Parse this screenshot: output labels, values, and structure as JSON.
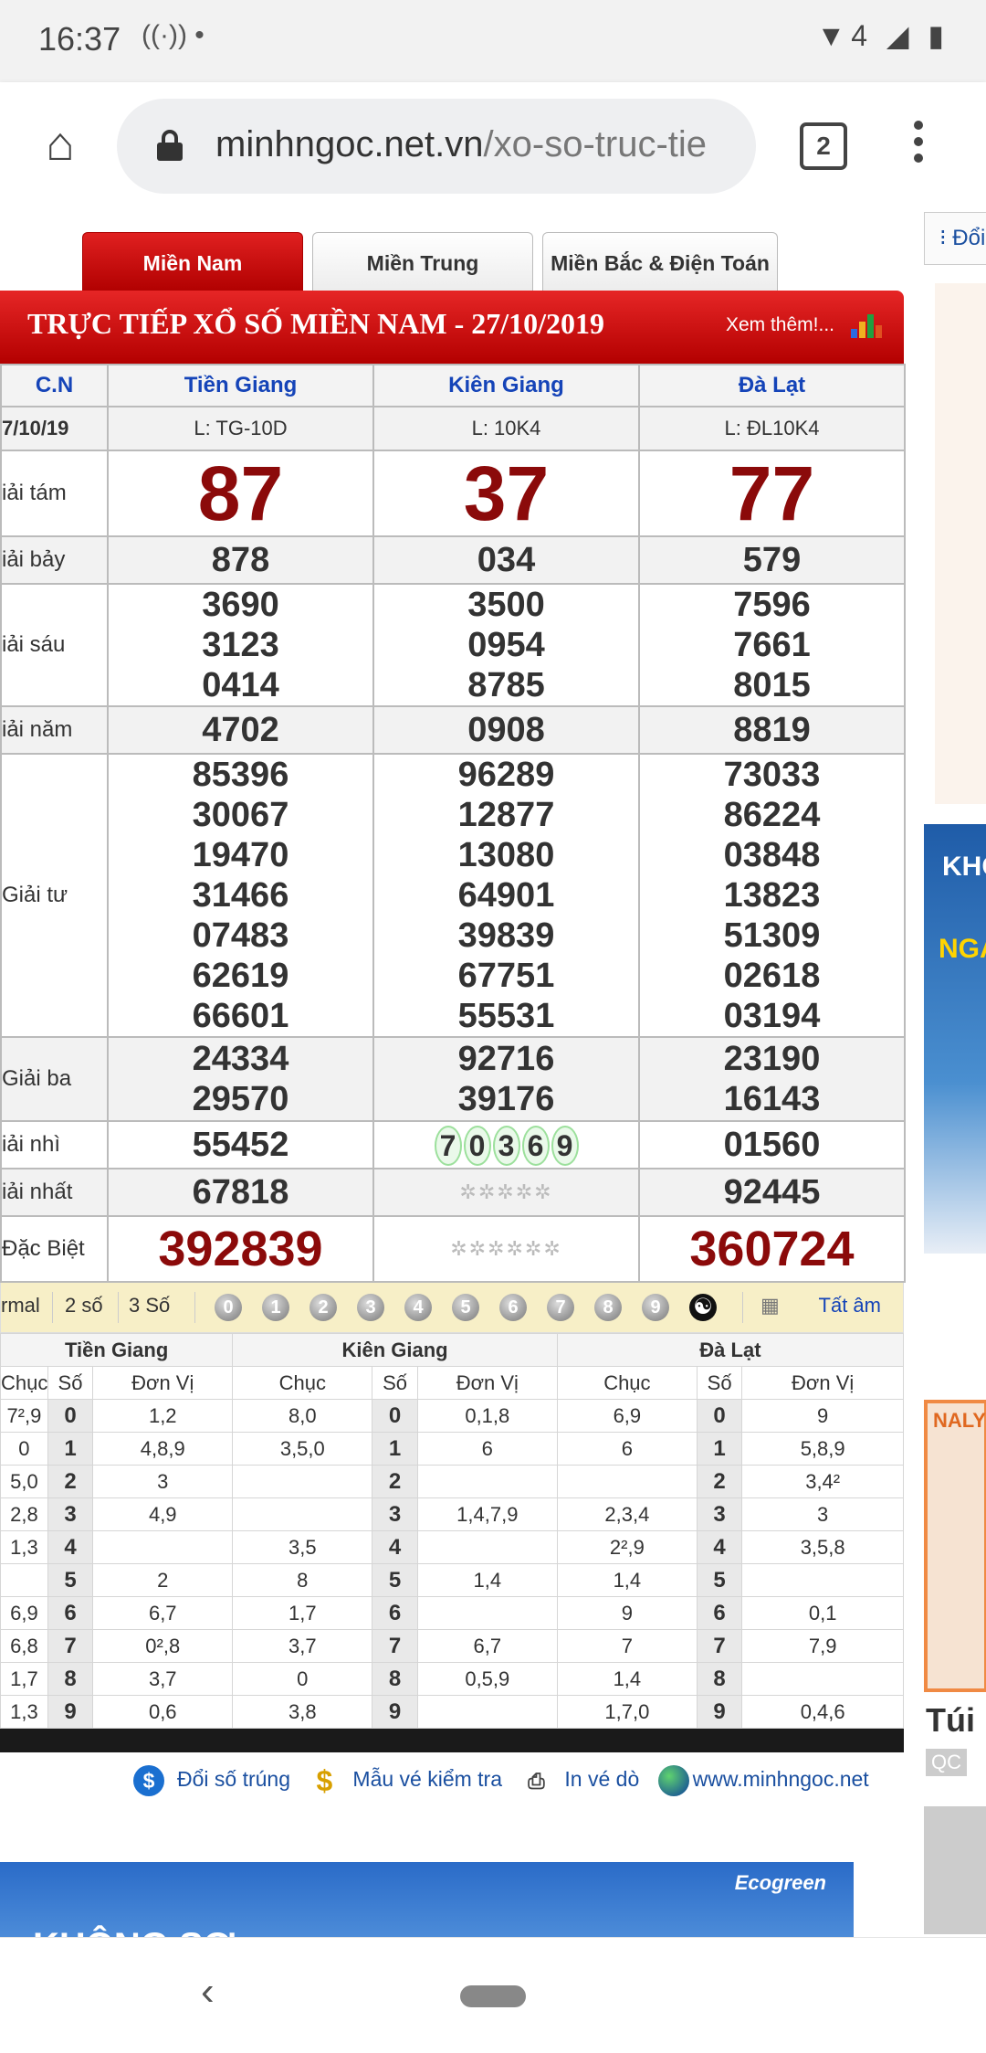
{
  "status": {
    "time": "16:37",
    "left_icons": "((·)) •",
    "right_icons": "▼4 ◢ ▮"
  },
  "browser": {
    "url_domain": "minhngoc.net.vn",
    "url_path": "/xo-so-truc-tie",
    "tab_count": "2"
  },
  "regions": [
    "Miền Nam",
    "Miền Trung",
    "Miền Bắc & Điện Toán"
  ],
  "side": {
    "doi": "⁝ Đổi",
    "ad_text1": "KHC",
    "ad_text2": "NGẠ",
    "ad3_text": "NALY",
    "tui": "Túi",
    "qc": "QC"
  },
  "panel": {
    "title": "TRỰC TIẾP XỔ SỐ MIỀN NAM - 27/10/2019",
    "more": "Xem thêm!...",
    "day": "C.N",
    "date": "7/10/19",
    "provinces": [
      "Tiền Giang",
      "Kiên Giang",
      "Đà Lạt"
    ],
    "codes": [
      "L: TG-10D",
      "L: 10K4",
      "L: ĐL10K4"
    ],
    "labels": {
      "g8": "iải tám",
      "g7": "iải bảy",
      "g6": "iải sáu",
      "g5": "iải năm",
      "g4": "Giải tư",
      "g3": "Giải ba",
      "g2": "iải nhì",
      "g1": "iải nhất",
      "db": "Đặc Biệt"
    },
    "g8": [
      "87",
      "37",
      "77"
    ],
    "g7": [
      "878",
      "034",
      "579"
    ],
    "g6": [
      [
        "3690",
        "3123",
        "0414"
      ],
      [
        "3500",
        "0954",
        "8785"
      ],
      [
        "7596",
        "7661",
        "8015"
      ]
    ],
    "g5": [
      "4702",
      "0908",
      "8819"
    ],
    "g4": [
      [
        "85396",
        "30067",
        "19470",
        "31466",
        "07483",
        "62619",
        "66601"
      ],
      [
        "96289",
        "12877",
        "13080",
        "64901",
        "39839",
        "67751",
        "55531"
      ],
      [
        "73033",
        "86224",
        "03848",
        "13823",
        "51309",
        "02618",
        "03194"
      ]
    ],
    "g3": [
      [
        "24334",
        "29570"
      ],
      [
        "92716",
        "39176"
      ],
      [
        "23190",
        "16143"
      ]
    ],
    "g2": [
      "55452",
      "70369",
      "01560"
    ],
    "g1": [
      "67818",
      "✲✲✲✲✲",
      "92445"
    ],
    "db": [
      "392839",
      "✲✲✲✲✲✲",
      "360724"
    ]
  },
  "toolbar": {
    "normal": "rmal",
    "two": "2 số",
    "three": "3 Số",
    "digits": [
      "0",
      "1",
      "2",
      "3",
      "4",
      "5",
      "6",
      "7",
      "8",
      "9"
    ],
    "yy": "☯",
    "all": "Tất âm"
  },
  "loto": {
    "provinces": [
      "Tiền Giang",
      "Kiên Giang",
      "Đà Lạt"
    ],
    "sub": {
      "chuc": "Chục",
      "so": "Số",
      "donvi": "Đơn Vị"
    },
    "rows": [
      [
        "7²,9",
        "0",
        "1,2",
        "8,0",
        "0",
        "0,1,8",
        "6,9",
        "0",
        "9"
      ],
      [
        "0",
        "1",
        "4,8,9",
        "3,5,0",
        "1",
        "6",
        "6",
        "1",
        "5,8,9"
      ],
      [
        "5,0",
        "2",
        "3",
        "",
        "2",
        "",
        "",
        "2",
        "3,4²"
      ],
      [
        "2,8",
        "3",
        "4,9",
        "",
        "3",
        "1,4,7,9",
        "2,3,4",
        "3",
        "3"
      ],
      [
        "1,3",
        "4",
        "",
        "3,5",
        "4",
        "",
        "2²,9",
        "4",
        "3,5,8"
      ],
      [
        "",
        "5",
        "2",
        "8",
        "5",
        "1,4",
        "1,4",
        "5",
        ""
      ],
      [
        "6,9",
        "6",
        "6,7",
        "1,7",
        "6",
        "",
        "9",
        "6",
        "0,1"
      ],
      [
        "6,8",
        "7",
        "0²,8",
        "3,7",
        "7",
        "6,7",
        "7",
        "7",
        "7,9"
      ],
      [
        "1,7",
        "8",
        "3,7",
        "0",
        "8",
        "0,5,9",
        "1,4",
        "8",
        ""
      ],
      [
        "1,3",
        "9",
        "0,6",
        "3,8",
        "9",
        "",
        "1,7,0",
        "9",
        "0,4,6"
      ]
    ]
  },
  "links": {
    "doi": "Đổi số trúng",
    "mau": "Mẫu vé kiểm tra",
    "in": "In vé dò",
    "site": "www.minhngoc.net"
  },
  "ad": {
    "text": "KHÔNG SỢ",
    "brand": "Ecogreen"
  }
}
